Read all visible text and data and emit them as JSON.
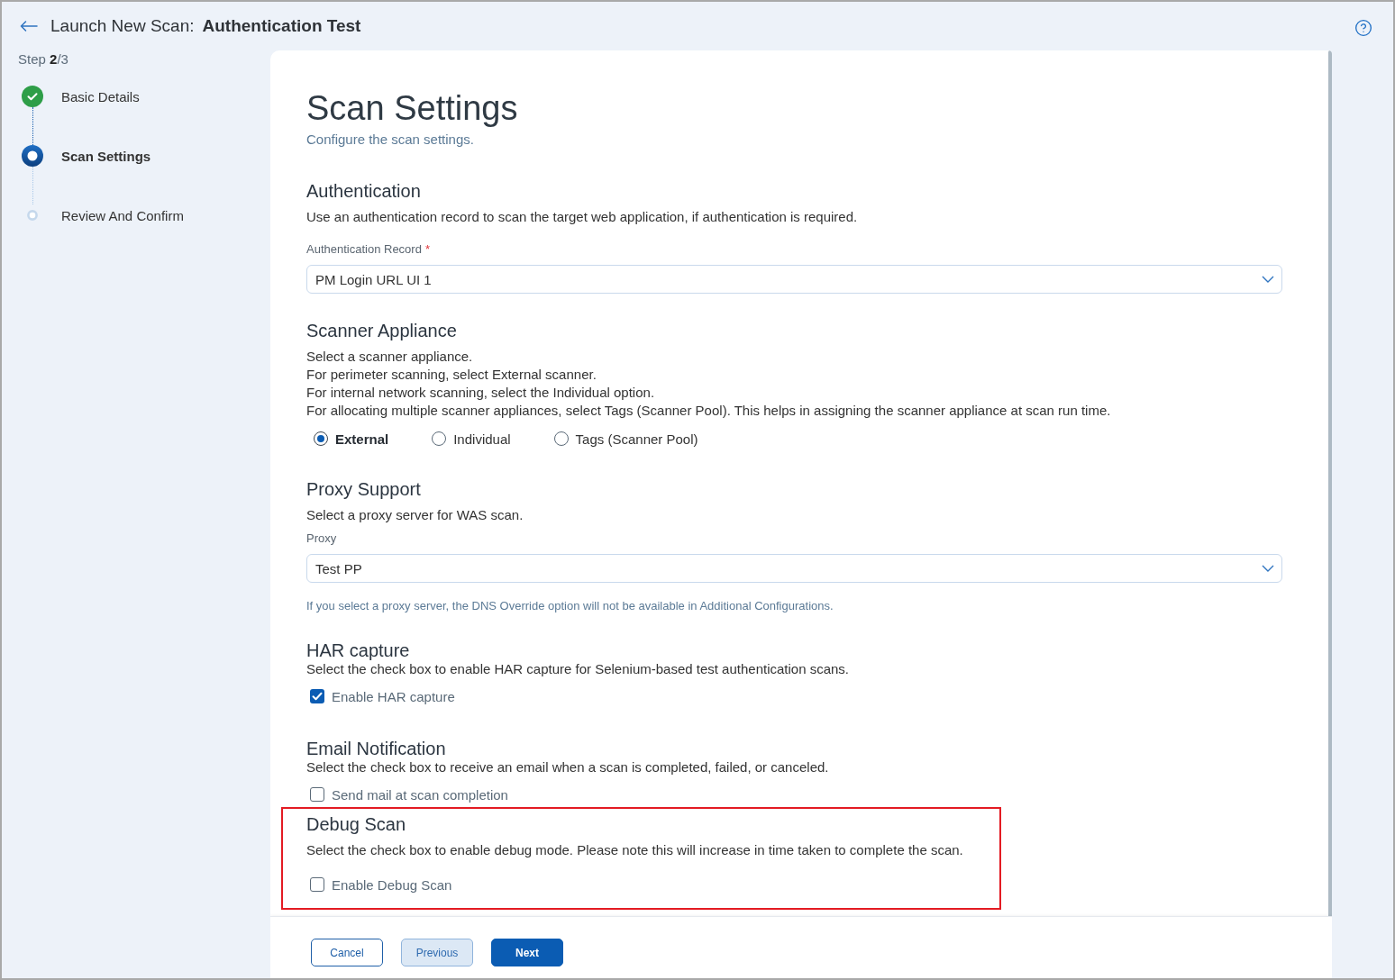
{
  "header": {
    "title": "Launch New Scan:",
    "scan_name": "Authentication Test"
  },
  "stepper": {
    "counter": "Step **2**/3",
    "steps": [
      {
        "label": "Basic Details",
        "completed": true,
        "selected": false
      },
      {
        "label": "Scan Settings",
        "completed": false,
        "selected": true
      },
      {
        "label": "Review And Confirm",
        "completed": false,
        "selected": false
      }
    ]
  },
  "page": {
    "title": "Scan Settings",
    "subtitle": "Configure the scan settings."
  },
  "sections": [
    {
      "kind": "select",
      "title": "Authentication",
      "highlighted": false,
      "description": [
        "Use an authentication record to scan the target web application, if authentication is required."
      ],
      "field": {
        "label": "Authentication Record",
        "required_mark": "*",
        "value": "PM Login URL UI 1"
      }
    },
    {
      "kind": "radio",
      "title": "Scanner Appliance",
      "highlighted": false,
      "description": [
        "Select a scanner appliance.",
        "For perimeter scanning, select External scanner.",
        "For internal network scanning, select the Individual option.",
        "For allocating multiple scanner appliances, select Tags (Scanner Pool). This helps in assigning the scanner appliance at scan run time."
      ],
      "options": [
        {
          "label": "External",
          "selected": true
        },
        {
          "label": "Individual",
          "selected": false
        },
        {
          "label": "Tags (Scanner Pool)",
          "selected": false
        }
      ]
    },
    {
      "kind": "select",
      "title": "Proxy Support",
      "highlighted": false,
      "description": [
        "Select a proxy server for WAS scan."
      ],
      "field": {
        "label": "Proxy",
        "value": "Test PP"
      },
      "hint": "If you select a proxy server, the DNS Override option will not be available in Additional Configurations."
    },
    {
      "kind": "checkbox",
      "title": "HAR capture",
      "highlighted": false,
      "description": [
        "Select the check box to enable HAR capture for Selenium-based test authentication scans."
      ],
      "checkbox": {
        "label": "Enable HAR capture",
        "checked": true
      }
    },
    {
      "kind": "checkbox",
      "title": "Email Notification",
      "highlighted": false,
      "description": [
        "Select the check box to receive an email when a scan is completed, failed, or canceled."
      ],
      "checkbox": {
        "label": "Send mail at scan completion",
        "checked": false
      }
    },
    {
      "kind": "checkbox",
      "title": "Debug Scan",
      "highlighted": true,
      "description": [
        "Select the check box to enable debug mode. Please note this will increase in time taken to complete the scan."
      ],
      "checkbox": {
        "label": "Enable Debug Scan",
        "checked": false
      }
    }
  ],
  "footer": {
    "buttons": [
      {
        "label": "Cancel",
        "kind": "outline"
      },
      {
        "label": "Previous",
        "kind": "soft"
      },
      {
        "label": "Next",
        "kind": "primary"
      }
    ]
  }
}
